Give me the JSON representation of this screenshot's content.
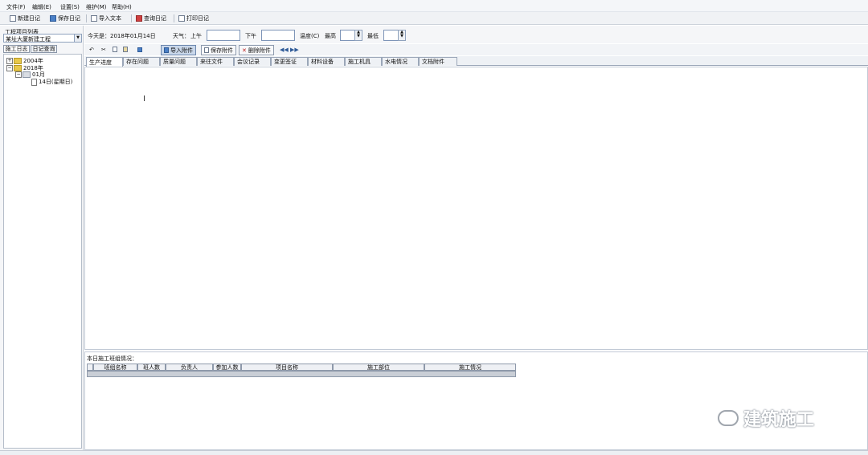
{
  "menu": [
    "文件(F)",
    "编辑(E)",
    "设置(S)",
    "维护(M)",
    "帮助(H)"
  ],
  "toolbar": {
    "new_diary": "新建日记",
    "save_diary": "保存日记",
    "import_text": "导入文本",
    "query_diary": "查询日记",
    "print_diary": "打印日记"
  },
  "left": {
    "project_list_label": "工程项目列表",
    "project_select": "某址大厦新建工程",
    "tab_diary": "施工日志",
    "tab_query": "日记查询",
    "tree": [
      "2004年",
      "2018年",
      "01月",
      "14日(星期日)"
    ]
  },
  "info": {
    "today": "今天是：2018年01月14日",
    "weather": "天气：",
    "am": "上午",
    "pm": "下午",
    "temp": "温度(C)",
    "max": "最高",
    "min": "最低"
  },
  "edit_toolbar": {
    "import_attach": "导入附件",
    "save_attach": "保存附件",
    "delete_attach": "删除附件"
  },
  "tabs": [
    "生产进度",
    "存在问题",
    "质量问题",
    "来往文件",
    "会议记录",
    "变更签证",
    "材料设备",
    "施工机具",
    "水电情况",
    "文档附件"
  ],
  "lower": {
    "title": "本日施工班组情况：",
    "columns": [
      "班组名称",
      "班人数",
      "负责人",
      "参加人数",
      "项目名称",
      "施工部位",
      "施工情况"
    ]
  },
  "watermark": "建筑施工",
  "colors": {
    "accent": "#4a7fc6",
    "tab_border": "#9aa6b8"
  }
}
